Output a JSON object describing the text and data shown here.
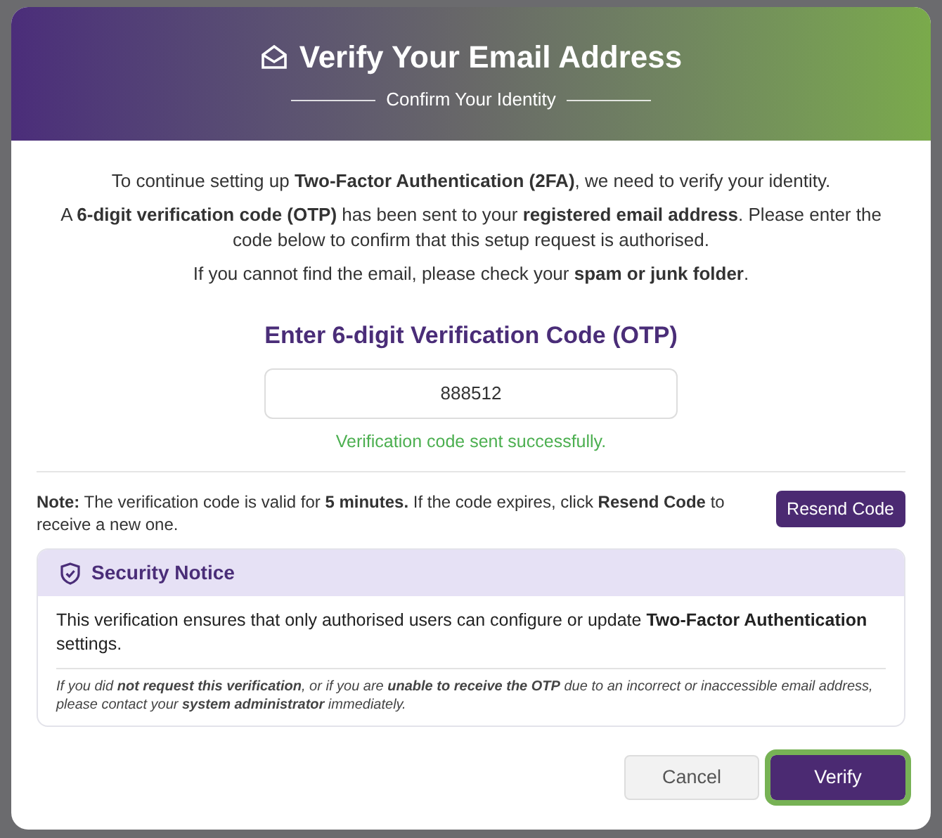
{
  "dialog": {
    "title": "Verify Your Email Address",
    "subtitle": "Confirm Your Identity",
    "intro": [
      "To continue setting up **Two-Factor Authentication (2FA)**, we need to verify your identity.",
      "A **6-digit verification code (OTP)** has been sent to your **registered email address**. Please enter the code below to confirm that this setup request is authorised.",
      "If you cannot find the email, please check your **spam or junk folder**."
    ],
    "code_label": "Enter 6-digit Verification Code (OTP)",
    "code_field": {
      "value": "888512"
    },
    "status_message": {
      "text": "Verification code sent successfully.",
      "kind": "success"
    },
    "note": "**Note:** The verification code is valid for **5 minutes.** If the code expires, click **Resend Code** to receive a new one.",
    "resend_button": "Resend Code",
    "security_notice": {
      "title": "Security Notice",
      "text": "This verification ensures that only authorised users can configure or update **Two-Factor Authentication** settings.",
      "footnote": "If you did **not request this verification**, or if you are **unable to receive the OTP** due to an incorrect or inaccessible email address, please contact your **system administrator** immediately."
    },
    "buttons": [
      {
        "label": "Cancel",
        "kind": "secondary",
        "focused": false
      },
      {
        "label": "Verify",
        "kind": "primary",
        "focused": true
      }
    ]
  }
}
